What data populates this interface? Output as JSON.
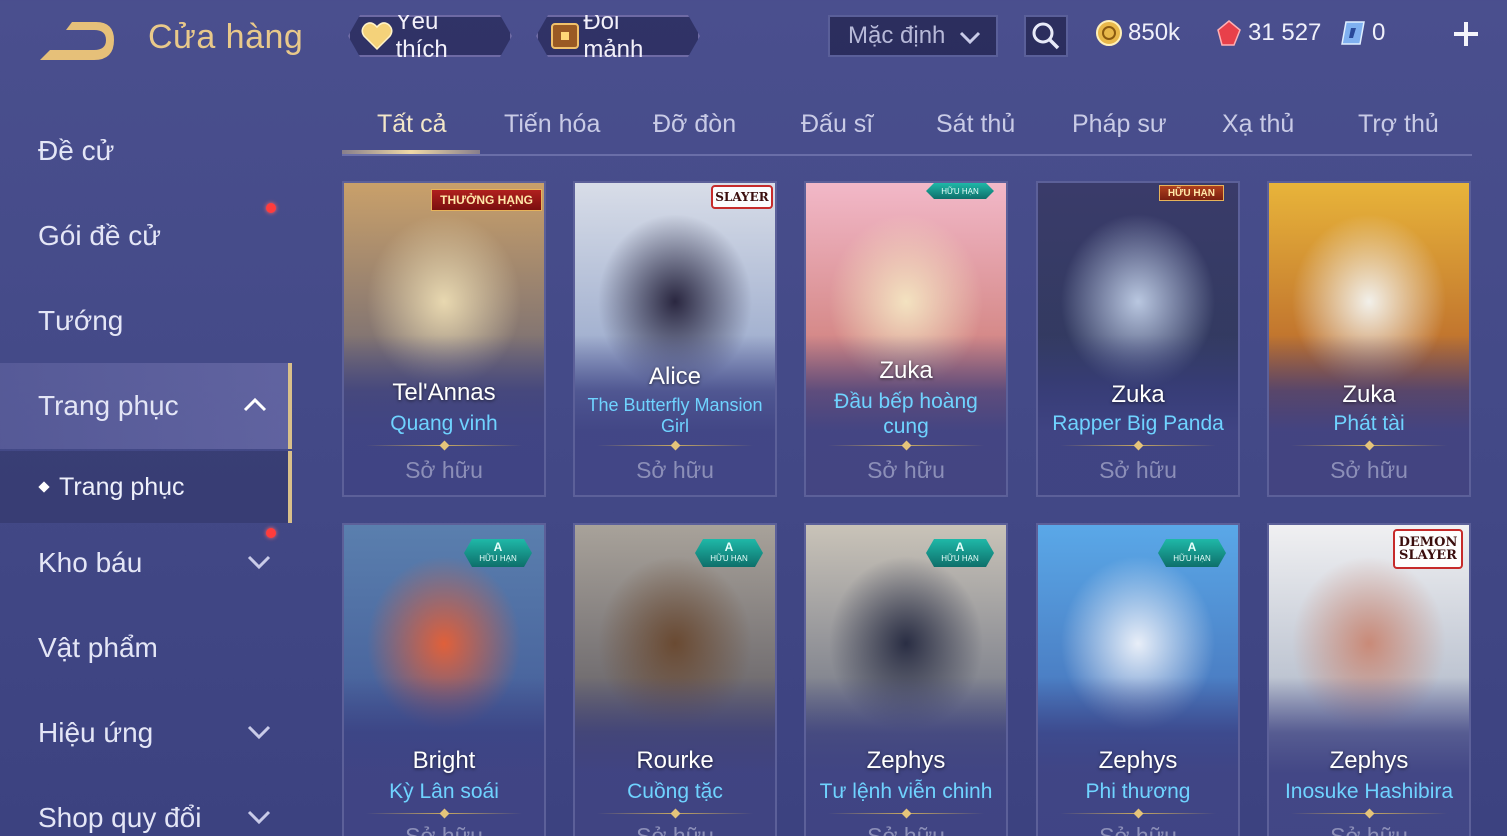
{
  "header": {
    "title": "Cửa hàng",
    "favorites_label": "Yêu thích",
    "exchange_label": "Đổi mảnh",
    "sort_value": "Mặc định",
    "gold": "850k",
    "ruby": "31 527",
    "voucher": "0"
  },
  "sidebar": {
    "items": [
      {
        "label": "Đề cử"
      },
      {
        "label": "Gói đề cử"
      },
      {
        "label": "Tướng"
      },
      {
        "label": "Trang phục"
      },
      {
        "label": "Trang phục"
      },
      {
        "label": "Kho báu"
      },
      {
        "label": "Vật phẩm"
      },
      {
        "label": "Hiệu ứng"
      },
      {
        "label": "Shop quy đổi"
      }
    ]
  },
  "tabs": [
    "Tất cả",
    "Tiến hóa",
    "Đỡ đòn",
    "Đấu sĩ",
    "Sát thủ",
    "Pháp sư",
    "Xạ thủ",
    "Trợ thủ"
  ],
  "badges": {
    "ranked": "THƯỞNG HẠNG",
    "limited": "HỮU HẠN",
    "grade": "A",
    "slayer": "SLAYER",
    "demon": "DEMON"
  },
  "cards": [
    {
      "hero": "Tel'Annas",
      "skin": "Quang vinh",
      "status": "Sở hữu",
      "top": "#c9a06a",
      "bottom": "#3d4a7a",
      "accent": "#e8d8b0"
    },
    {
      "hero": "Alice",
      "skin": "The Butterfly Mansion Girl",
      "status": "Sở hữu",
      "top": "#d8dde8",
      "bottom": "#6f86b8",
      "accent": "#2a2740"
    },
    {
      "hero": "Zuka",
      "skin": "Đầu bếp hoàng cung",
      "status": "Sở hữu",
      "top": "#f2b8c8",
      "bottom": "#b85a48",
      "accent": "#f3e2c0"
    },
    {
      "hero": "Zuka",
      "skin": "Rapper Big Panda",
      "status": "Sở hữu",
      "top": "#3a3b6a",
      "bottom": "#2c3a58",
      "accent": "#b9c7e0"
    },
    {
      "hero": "Zuka",
      "skin": "Phát tài",
      "status": "Sở hữu",
      "top": "#e8b43a",
      "bottom": "#9a3522",
      "accent": "#f2f0ea"
    },
    {
      "hero": "Bright",
      "skin": "Kỳ Lân soái",
      "status": "Sở hữu",
      "top": "#5a7fae",
      "bottom": "#3a4c8e",
      "accent": "#e0603a"
    },
    {
      "hero": "Rourke",
      "skin": "Cuồng tặc",
      "status": "Sở hữu",
      "top": "#a8a29a",
      "bottom": "#3c3a48",
      "accent": "#6a4a32"
    },
    {
      "hero": "Zephys",
      "skin": "Tư lệnh viễn chinh",
      "status": "Sở hữu",
      "top": "#c9c3b8",
      "bottom": "#3f4a68",
      "accent": "#2a2e44"
    },
    {
      "hero": "Zephys",
      "skin": "Phi thương",
      "status": "Sở hữu",
      "top": "#5aa8e8",
      "bottom": "#3c55a0",
      "accent": "#e8eef8"
    },
    {
      "hero": "Zephys",
      "skin": "Inosuke Hashibira",
      "status": "Sở hữu",
      "top": "#f0f0f2",
      "bottom": "#8a98b0",
      "accent": "#c98a78"
    }
  ]
}
